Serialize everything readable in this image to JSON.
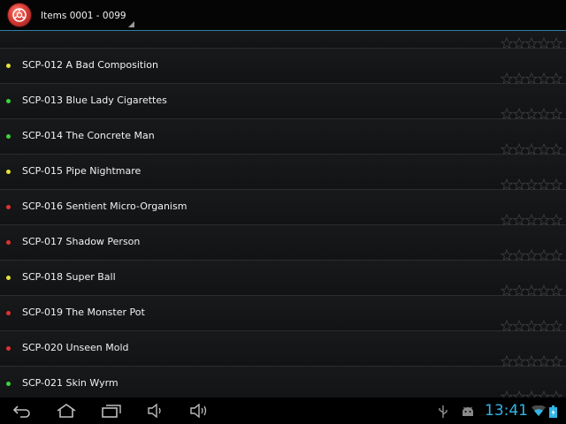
{
  "header": {
    "nav_title": "Items 0001 - 0099"
  },
  "items": [
    {
      "title": "",
      "status": "none"
    },
    {
      "title": "SCP-012 A Bad Composition",
      "status": "yellow"
    },
    {
      "title": "SCP-013 Blue Lady Cigarettes",
      "status": "green"
    },
    {
      "title": "SCP-014 The Concrete Man",
      "status": "green"
    },
    {
      "title": "SCP-015 Pipe Nightmare",
      "status": "yellow"
    },
    {
      "title": "SCP-016 Sentient Micro-Organism",
      "status": "red"
    },
    {
      "title": "SCP-017 Shadow Person",
      "status": "red"
    },
    {
      "title": "SCP-018 Super Ball",
      "status": "yellow"
    },
    {
      "title": "SCP-019 The Monster Pot",
      "status": "red"
    },
    {
      "title": "SCP-020 Unseen Mold",
      "status": "red"
    },
    {
      "title": "SCP-021 Skin Wyrm",
      "status": "green"
    }
  ],
  "status_colors": {
    "yellow": "#e8e23a",
    "green": "#3cd23c",
    "red": "#e03232"
  },
  "rating_icon": "star-outline-icon",
  "system_bar": {
    "clock": "13:41",
    "icons": [
      "back-icon",
      "home-icon",
      "recent-apps-icon",
      "volume-down-icon",
      "volume-up-icon",
      "usb-icon",
      "android-debug-icon",
      "wifi-icon",
      "battery-icon"
    ]
  },
  "accent_color": "#33b5e5"
}
